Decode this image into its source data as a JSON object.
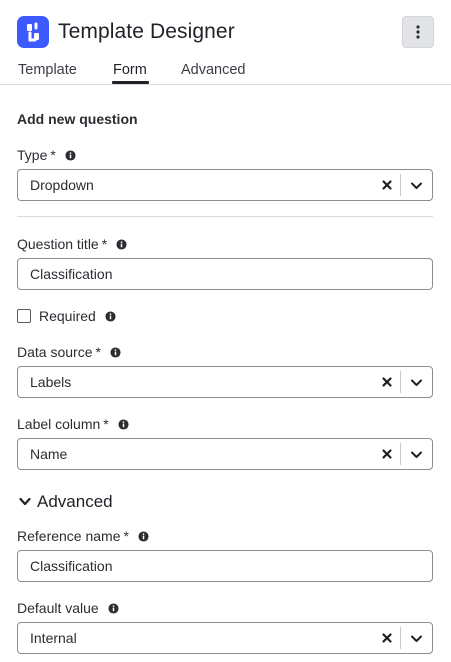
{
  "app": {
    "title": "Template Designer",
    "accent_color": "#3d5afe"
  },
  "header": {
    "menu_icon": "more-vertical-icon"
  },
  "tabs": [
    {
      "label": "Template",
      "active": false
    },
    {
      "label": "Form",
      "active": true
    },
    {
      "label": "Advanced",
      "active": false
    }
  ],
  "form": {
    "section_title": "Add new question",
    "type": {
      "label": "Type",
      "required_mark": "*",
      "value": "Dropdown"
    },
    "question_title": {
      "label": "Question title",
      "required_mark": "*",
      "value": "Classification"
    },
    "required_checkbox": {
      "label": "Required",
      "checked": false
    },
    "data_source": {
      "label": "Data source",
      "required_mark": "*",
      "value": "Labels"
    },
    "label_column": {
      "label": "Label column",
      "required_mark": "*",
      "value": "Name"
    },
    "advanced": {
      "label": "Advanced",
      "expanded": true,
      "reference_name": {
        "label": "Reference name",
        "required_mark": "*",
        "value": "Classification"
      },
      "default_value": {
        "label": "Default value",
        "value": "Internal"
      }
    }
  }
}
